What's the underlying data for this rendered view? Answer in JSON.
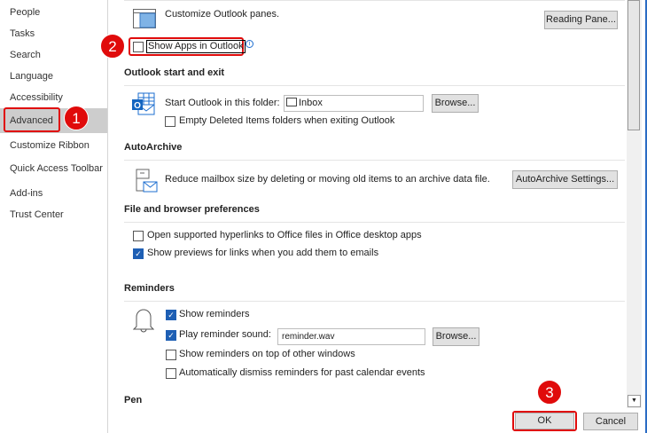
{
  "sidebar": {
    "items": [
      "People",
      "Tasks",
      "Search",
      "Language",
      "Accessibility",
      "Advanced",
      "Customize Ribbon",
      "Quick Access Toolbar",
      "Add-ins",
      "Trust Center"
    ],
    "selected": "Advanced"
  },
  "panes": {
    "text": "Customize Outlook panes.",
    "button": "Reading Pane..."
  },
  "show_apps": {
    "label": "Show Apps in Outlook",
    "checked": false
  },
  "start_exit": {
    "heading": "Outlook start and exit",
    "folder_label": "Start Outlook in this folder:",
    "folder_value": "Inbox",
    "browse": "Browse...",
    "empty_deleted": "Empty Deleted Items folders when exiting Outlook"
  },
  "autoarchive": {
    "heading": "AutoArchive",
    "text": "Reduce mailbox size by deleting or moving old items to an archive data file.",
    "button": "AutoArchive Settings..."
  },
  "file_browser": {
    "heading": "File and browser preferences",
    "open_links": "Open supported hyperlinks to Office files in Office desktop apps",
    "show_previews": "Show previews for links when you add them to emails"
  },
  "reminders": {
    "heading": "Reminders",
    "show": "Show reminders",
    "play": "Play reminder sound:",
    "sound_file": "reminder.wav",
    "browse": "Browse...",
    "on_top": "Show reminders on top of other windows",
    "auto_dismiss": "Automatically dismiss reminders for past calendar events"
  },
  "pen": {
    "heading": "Pen"
  },
  "footer": {
    "ok": "OK",
    "cancel": "Cancel"
  },
  "badges": [
    "1",
    "2",
    "3"
  ],
  "colors": {
    "accent": "#1e5fb4",
    "highlight": "#e00b0b"
  }
}
